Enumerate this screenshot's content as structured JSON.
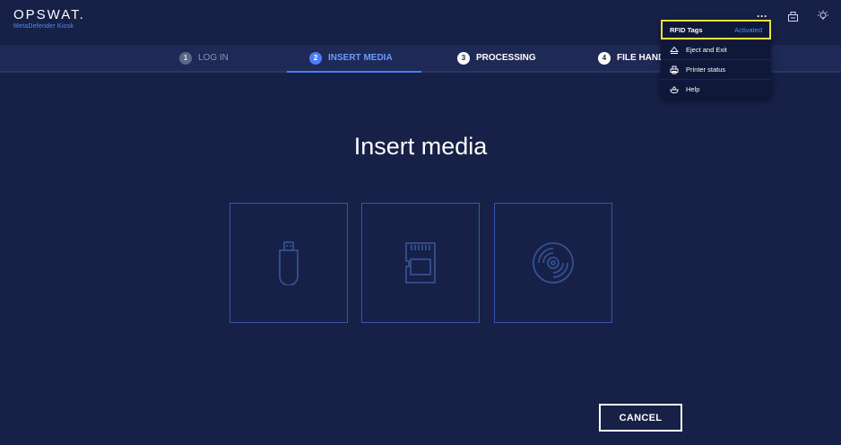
{
  "header": {
    "logo": "OPSWAT.",
    "subtitle": "MetaDefender Kiosk",
    "more_icon": "ellipsis-icon",
    "kiosk_icon": "kiosk-icon",
    "light_icon": "lightbulb-icon"
  },
  "steps": [
    {
      "num": "1",
      "label": "LOG IN",
      "state": "done"
    },
    {
      "num": "2",
      "label": "INSERT MEDIA",
      "state": "active"
    },
    {
      "num": "3",
      "label": "PROCESSING",
      "state": "todo"
    },
    {
      "num": "4",
      "label": "FILE HAND",
      "state": "todo"
    }
  ],
  "main": {
    "title": "Insert media",
    "media": [
      {
        "icon": "usb-drive-icon"
      },
      {
        "icon": "sd-card-icon"
      },
      {
        "icon": "optical-disc-icon"
      }
    ],
    "cancel_label": "CANCEL"
  },
  "menu": {
    "rfid_label": "RFID Tags",
    "rfid_status": "Activated",
    "items": [
      {
        "label": "Eject and Exit",
        "icon": "eject-icon"
      },
      {
        "label": "Printer status",
        "icon": "printer-icon"
      },
      {
        "label": "Help",
        "icon": "help-icon"
      }
    ]
  },
  "colors": {
    "background": "#172047",
    "accent": "#4b7df6",
    "highlight": "#e6e23a"
  }
}
